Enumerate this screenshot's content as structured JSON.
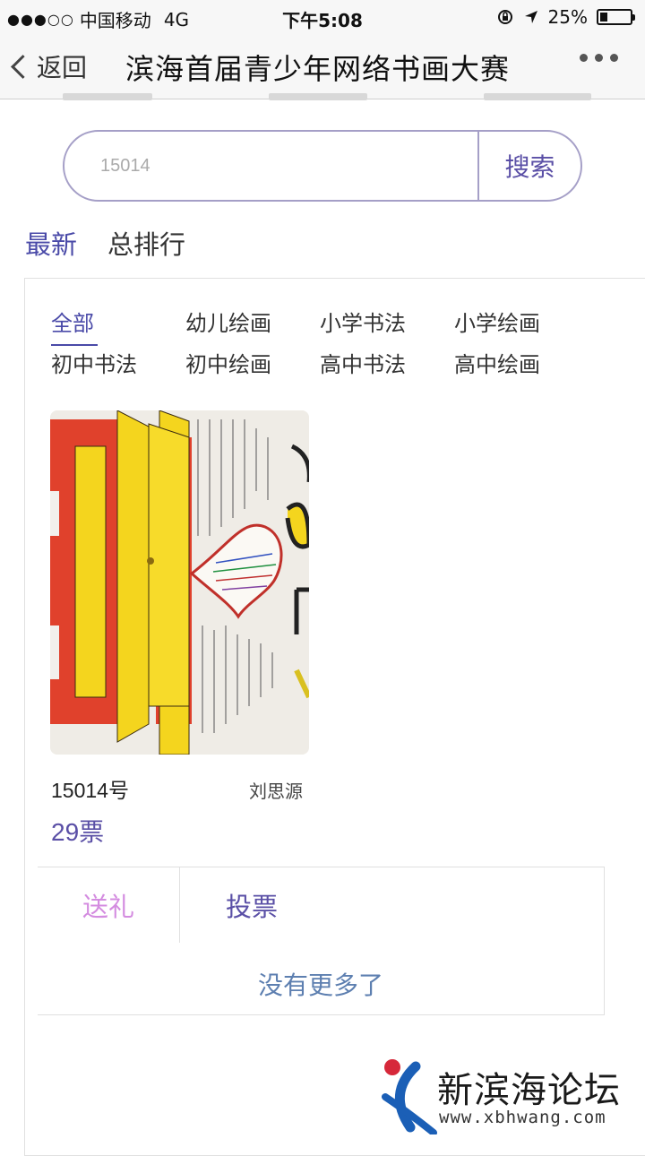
{
  "status_bar": {
    "carrier": "中国移动",
    "network": "4G",
    "time": "下午5:08",
    "battery": "25%",
    "battery_level": 0.25
  },
  "nav": {
    "back_label": "返回",
    "title": "滨海首届青少年网络书画大赛"
  },
  "search": {
    "value": "15014",
    "button_label": "搜索"
  },
  "main_tabs": [
    {
      "label": "最新",
      "active": true
    },
    {
      "label": "总排行",
      "active": false
    }
  ],
  "categories": [
    {
      "label": "全部",
      "active": true
    },
    {
      "label": "幼儿绘画"
    },
    {
      "label": "小学书法"
    },
    {
      "label": "小学绘画"
    },
    {
      "label": "初中书法"
    },
    {
      "label": "初中绘画"
    },
    {
      "label": "高中书法"
    },
    {
      "label": "高中绘画"
    }
  ],
  "entry": {
    "number": "15014号",
    "name": "刘思源",
    "votes": "29票"
  },
  "actions": {
    "gift_label": "送礼",
    "vote_label": "投票"
  },
  "list_end_text": "没有更多了",
  "watermark": {
    "name": "新滨海论坛",
    "url": "www.xbhwang.com"
  },
  "colors": {
    "accent": "#5a4fa6",
    "gift": "#d48ce0",
    "no_more": "#5d7fb0"
  }
}
